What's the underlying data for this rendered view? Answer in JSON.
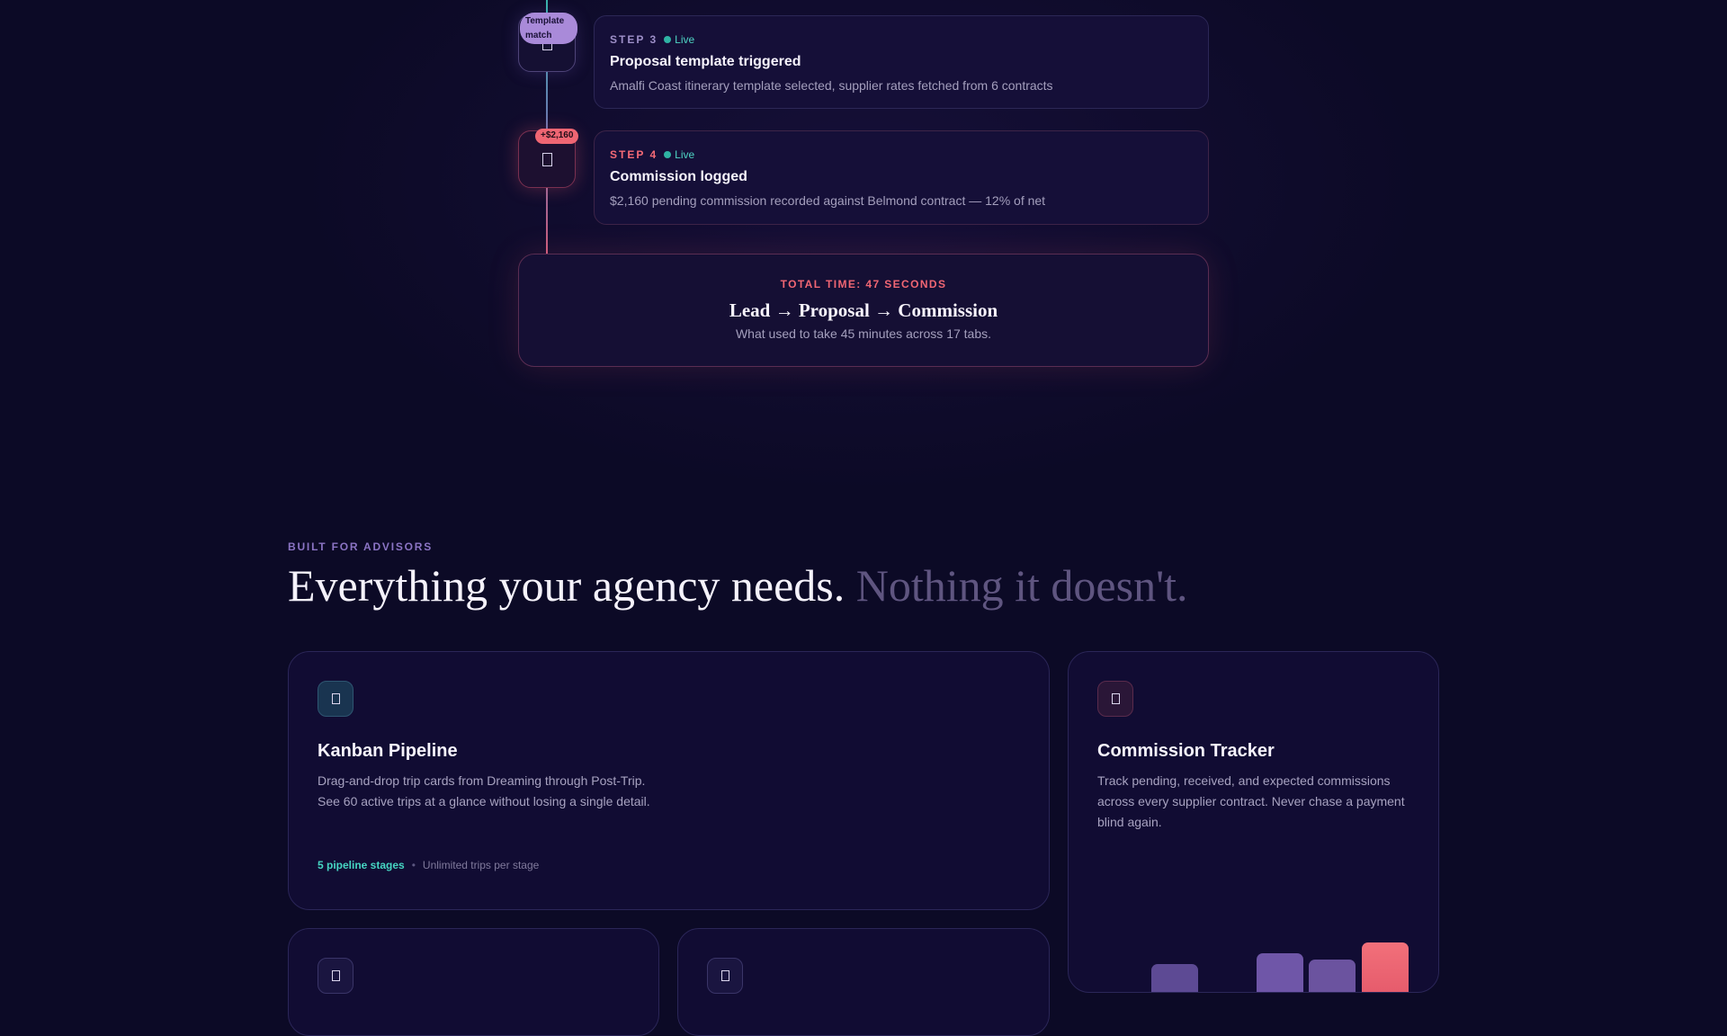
{
  "timeline": {
    "steps": [
      {
        "label": "STEP 3",
        "live": "Live",
        "title": "Proposal template triggered",
        "description": "Amalfi Coast itinerary template selected, supplier rates fetched from 6 contracts",
        "badge": "Template match",
        "icon": "document-icon"
      },
      {
        "label": "STEP 4",
        "live": "Live",
        "title": "Commission logged",
        "description": "$2,160 pending commission recorded against Belmond contract — 12% of net",
        "badge": "+$2,160",
        "icon": "document-icon"
      }
    ],
    "total": {
      "label": "TOTAL TIME: 47 SECONDS",
      "flow": "Lead → Proposal → Commission",
      "subtext": "What used to take 45 minutes across 17 tabs."
    }
  },
  "features_section": {
    "eyebrow": "BUILT FOR ADVISORS",
    "headline_main": "Everything your agency needs.",
    "headline_muted": "Nothing it doesn't.",
    "cards": {
      "kanban": {
        "title": "Kanban Pipeline",
        "description_line1": "Drag-and-drop trip cards from Dreaming through Post-Trip.",
        "description_line2": "See 60 active trips at a glance without losing a single detail.",
        "meta_strong": "5 pipeline stages",
        "meta_separator": "•",
        "meta_weak": "Unlimited trips per stage",
        "icon": "kanban-icon"
      },
      "commission": {
        "title": "Commission Tracker",
        "description_line1": "Track pending, received, and expected commissions",
        "description_line2": "across every supplier contract. Never chase a payment",
        "description_line3": "blind again.",
        "icon": "commission-icon",
        "colors": {
          "bar": "#6f56a8",
          "bar_highlight": "#f0686f"
        }
      }
    }
  },
  "colors": {
    "background": "#0c0a26",
    "accent_teal": "#46d6c3",
    "accent_red": "#f06673",
    "accent_purple": "#a98ad9"
  }
}
